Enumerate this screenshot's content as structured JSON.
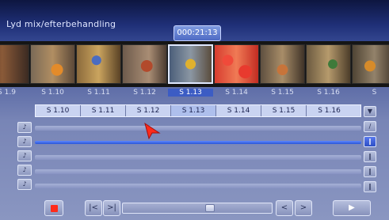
{
  "title": "Lyd mix/efterbehandling",
  "timecode": "000:21:13",
  "filmstrip": {
    "frame_labels": [
      "S 1.9",
      "S 1.10",
      "S 1.11",
      "S 1.12",
      "S 1.13",
      "S 1.14",
      "S 1.15",
      "S 1.16",
      "S"
    ],
    "selected_index": 4
  },
  "clips": [
    "S 1.10",
    "S 1.11",
    "S 1.12",
    "S 1.13",
    "S 1.14",
    "S 1.15",
    "S 1.16"
  ],
  "selected_clip_index": 3,
  "track_buttons": [
    "♪",
    "♪",
    "♪",
    "♪",
    "♪",
    "♪"
  ],
  "right_buttons": [
    "▼",
    "∕",
    "‖",
    "‖",
    "‖",
    "‖"
  ],
  "controls": {
    "prev_label": "|<",
    "next_label": ">|",
    "left_label": "<",
    "right_label": ">",
    "play_label": "▶"
  },
  "colors": {
    "accent": "#2a56d8",
    "record": "#ff2a1a"
  }
}
